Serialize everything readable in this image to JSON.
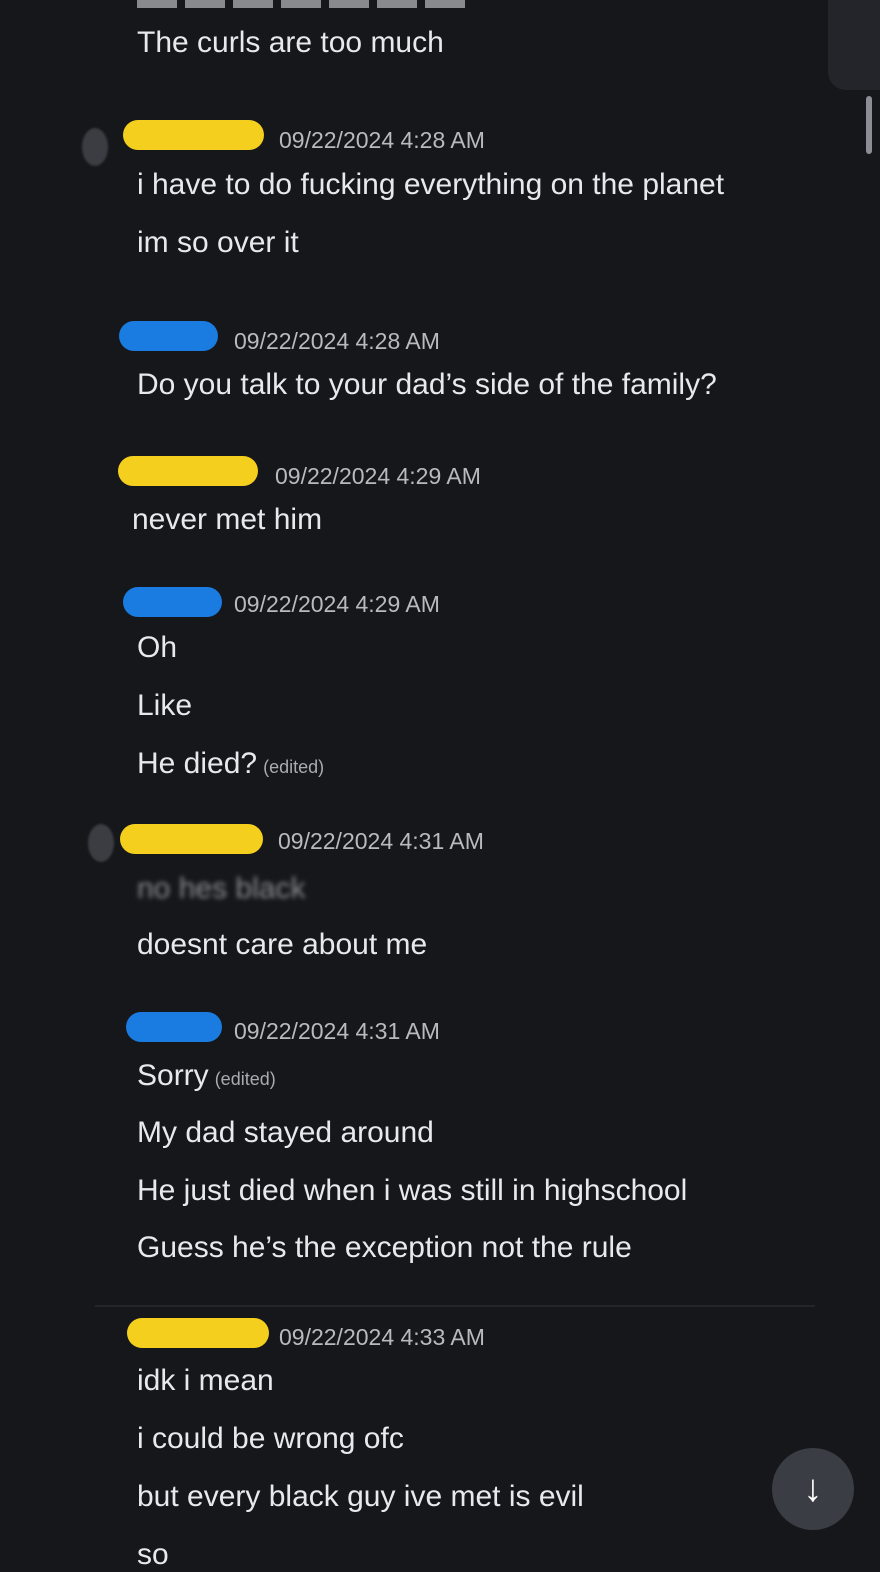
{
  "colors": {
    "background": "#16171b",
    "redaction_yellow": "#f5cf1d",
    "redaction_blue": "#1a7be0",
    "timestamp": "#b8bac0",
    "message_text": "#e8e9ec"
  },
  "messages": [
    {
      "lines": [
        "The curls are too much"
      ]
    },
    {
      "author_redaction": "yellow",
      "timestamp": "09/22/2024 4:28 AM",
      "lines": [
        "i have to do fucking everything on the planet",
        "im so over it"
      ]
    },
    {
      "author_redaction": "blue",
      "timestamp": "09/22/2024 4:28 AM",
      "lines": [
        "Do you talk to your dad’s side of the family?"
      ]
    },
    {
      "author_redaction": "yellow",
      "timestamp": "09/22/2024 4:29 AM",
      "lines": [
        "never met him"
      ]
    },
    {
      "author_redaction": "blue",
      "timestamp": "09/22/2024 4:29 AM",
      "lines": [
        "Oh",
        "Like",
        "He died?"
      ],
      "edited": "(edited)"
    },
    {
      "author_redaction": "yellow",
      "timestamp": "09/22/2024 4:31 AM",
      "lines": [
        "no hes black",
        "doesnt care about me"
      ]
    },
    {
      "author_redaction": "blue",
      "timestamp": "09/22/2024 4:31 AM",
      "lines": [
        "Sorry",
        "My dad stayed around",
        "He just died when i was still in highschool",
        "Guess he’s the exception not the rule"
      ],
      "edited": "(edited)"
    },
    {
      "author_redaction": "yellow",
      "timestamp": "09/22/2024 4:33 AM",
      "lines": [
        "idk i mean",
        "i could be wrong ofc",
        "but every black guy ive met is evil",
        "so"
      ]
    }
  ],
  "controls": {
    "jump_to_present_icon": "arrow-down-icon",
    "jump_glyph": "↓"
  }
}
